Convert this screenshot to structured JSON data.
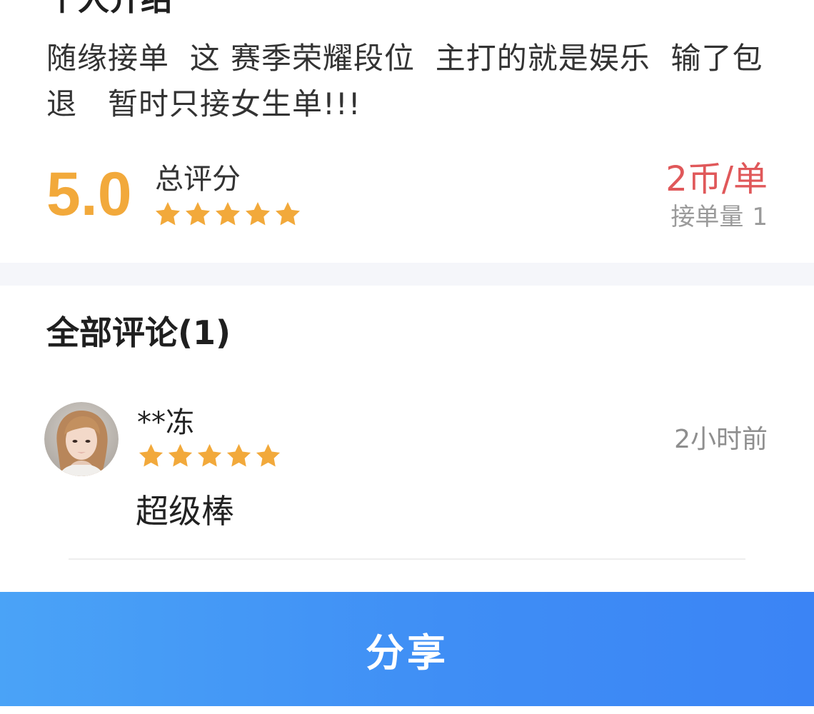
{
  "header": {
    "cut_title": "个人介绍"
  },
  "intro": {
    "text": "随缘接单  这 赛季荣耀段位  主打的就是娱乐  输了包退   暂时只接女生单!!!"
  },
  "rating": {
    "score": "5.0",
    "label": "总评分",
    "stars": 5,
    "price": "2币/单",
    "orders_label": "接单量",
    "orders_count": "1"
  },
  "comments_section": {
    "title": "全部评论(1)",
    "items": [
      {
        "user": "**冻",
        "stars": 5,
        "time": "2小时前",
        "body": "超级棒",
        "avatar": "user-avatar-photo"
      }
    ]
  },
  "share": {
    "label": "分享"
  },
  "colors": {
    "score": "#f2a93b",
    "star": "#f2a93b",
    "price": "#e0585a",
    "button_start": "#4aa3f7",
    "button_end": "#3b84f5",
    "band": "#f5f6fa"
  }
}
